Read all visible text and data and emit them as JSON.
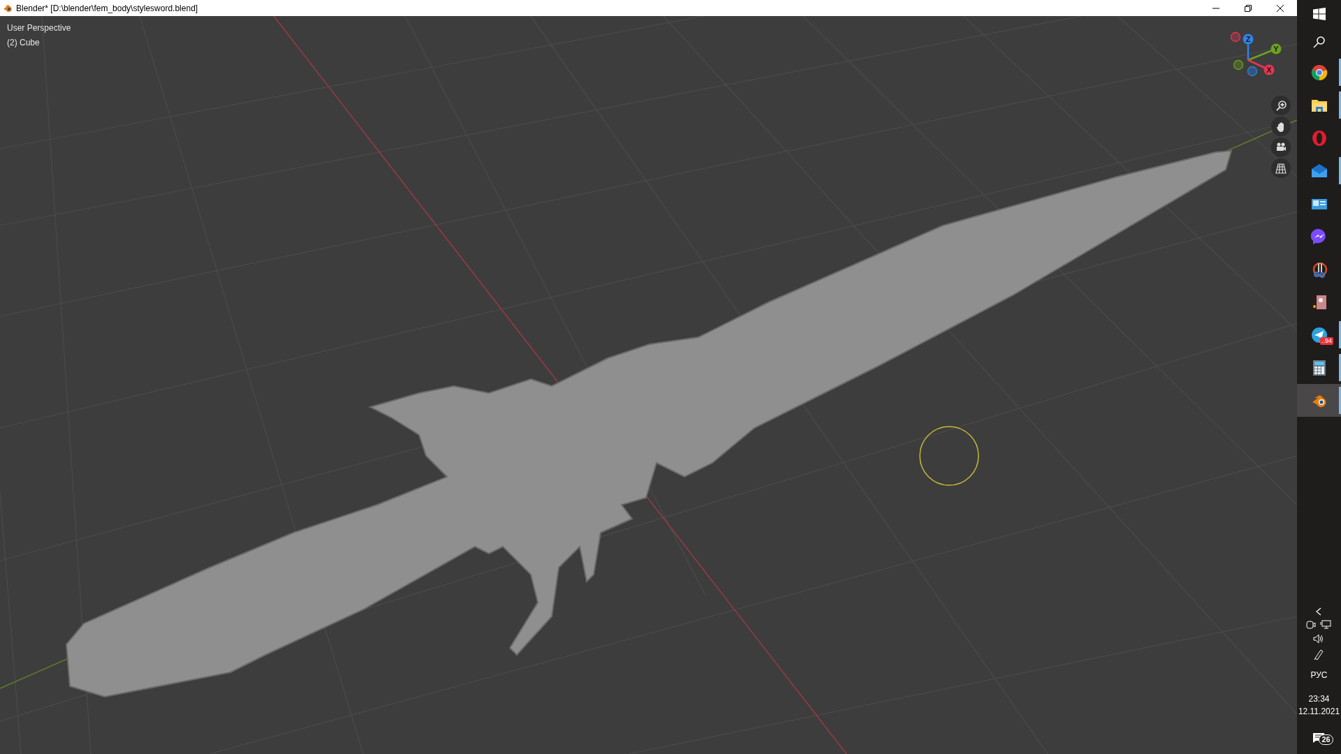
{
  "window": {
    "title": "Blender* [D:\\blender\\fem_body\\stylesword.blend]"
  },
  "viewport": {
    "view_name": "User Perspective",
    "object_info": "(2) Cube"
  },
  "gizmo": {
    "axes": [
      {
        "label": "Z",
        "color": "#2f83e6"
      },
      {
        "label": "Y",
        "color": "#6ea11f"
      },
      {
        "label": "X",
        "color": "#e63650"
      }
    ]
  },
  "navigation": [
    {
      "kind": "zoom"
    },
    {
      "kind": "pan"
    },
    {
      "kind": "camera"
    },
    {
      "kind": "ortho"
    }
  ],
  "taskbar": {
    "apps": [
      {
        "kind": "chrome",
        "running": true,
        "selected": false
      },
      {
        "kind": "explorer",
        "running": true,
        "selected": false
      },
      {
        "kind": "opera",
        "running": false,
        "selected": false
      },
      {
        "kind": "mail",
        "running": true,
        "selected": false
      },
      {
        "kind": "control",
        "running": false,
        "selected": false
      },
      {
        "kind": "messenger",
        "running": false,
        "selected": false
      },
      {
        "kind": "snip",
        "running": false,
        "selected": false
      },
      {
        "kind": "picture",
        "running": false,
        "selected": false
      },
      {
        "kind": "telegram",
        "running": true,
        "selected": false,
        "badge": "..94"
      },
      {
        "kind": "calculator",
        "running": true,
        "selected": false
      },
      {
        "kind": "blender",
        "running": true,
        "selected": true
      }
    ],
    "tray": {
      "language": "РУС",
      "time": "23:34",
      "date": "12.11.2021",
      "notifications": "26"
    }
  }
}
